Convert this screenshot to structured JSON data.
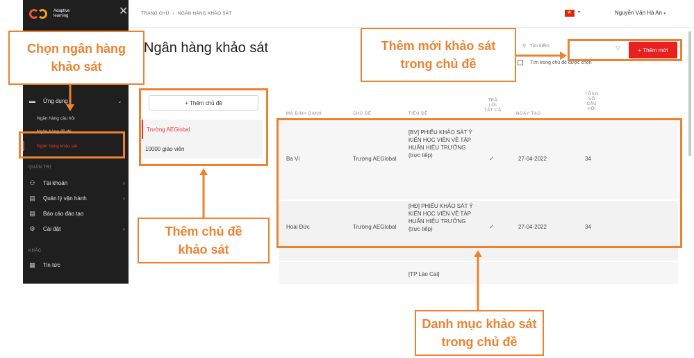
{
  "app": {
    "logo_text_line1": "Adaptive",
    "logo_text_line2": "learning"
  },
  "sidebar": {
    "close_glyph": "✕",
    "apps_label": "Ứng dụng",
    "apps_sub": [
      "Ngân hàng câu hỏi",
      "Ngân hàng đề thi",
      "Ngân hàng khảo sát"
    ],
    "admin_section": "QUẢN TRỊ",
    "admin_items": [
      {
        "label": "Tài khoản",
        "icon": "users-icon"
      },
      {
        "label": "Quản lý vận hành",
        "icon": "document-icon"
      },
      {
        "label": "Báo cáo đào tạo",
        "icon": "report-icon"
      },
      {
        "label": "Cài đặt",
        "icon": "gear-icon"
      }
    ],
    "other_section": "KHÁC",
    "other_items": [
      {
        "label": "Tin tức",
        "icon": "news-icon"
      }
    ]
  },
  "header": {
    "breadcrumb": [
      "TRANG CHỦ",
      "NGÂN HÀNG KHẢO SÁT"
    ],
    "breadcrumb_sep": "›",
    "user_name": "Nguyễn Văn Hà An",
    "user_caret": "▾",
    "flag_caret": "▾"
  },
  "main": {
    "title": "Ngân hàng khảo sát",
    "search_placeholder": "Tìm kiếm",
    "add_button": "+ Thêm mới",
    "filter_checkbox_label": "Tìm trong chủ đề được chọn",
    "add_topic_button": "+ Thêm chủ đề",
    "topics": [
      "Trường AEGlobal",
      "10000 giáo viên"
    ]
  },
  "table": {
    "headers": {
      "code": "MÃ ĐỊNH DANH",
      "topic": "CHỦ ĐỀ",
      "title": "TIÊU ĐỀ",
      "all_answered": "TRẢ\nLỜI\nTẤT CẢ",
      "date": "NGÀY TẠO",
      "count": "TỔNG\nSỐ\nCÂU\nHỎI"
    },
    "rows": [
      {
        "code": "Ba Vì",
        "topic": "Trường AEGlobal",
        "title": "[BV] PHIẾU KHẢO SÁT Ý KIẾN HỌC VIÊN VỀ TẬP HUẤN HIỆU TRƯỞNG",
        "title_suffix": "(trực tiếp)",
        "all_answered": "✓",
        "date": "27-04-2022",
        "count": "34"
      },
      {
        "code": "Hoài Đức",
        "topic": "Trường AEGlobal",
        "title": "[HĐ] PHIẾU KHẢO SÁT Ý KIẾN HỌC VIÊN VỀ TẬP HUẤN HIỆU TRƯỞNG",
        "title_suffix": "(trực tiếp)",
        "all_answered": "✓",
        "date": "27-04-2022",
        "count": "34"
      },
      {
        "code": "",
        "topic": "",
        "title": "[TP Lào Cai]",
        "title_suffix": "",
        "all_answered": "",
        "date": "",
        "count": ""
      }
    ]
  },
  "annotations": {
    "choose_bank": "Chọn ngân hàng khảo sát",
    "add_new": "Thêm mới khảo sát trong chủ đề",
    "add_topic": "Thêm chủ đề khảo sát",
    "list": "Danh mục khảo sát trong chủ đề"
  },
  "colors": {
    "accent_red": "#e8201e",
    "annotation_orange": "#ee8130",
    "sidebar_bg": "#1f1f1f"
  }
}
